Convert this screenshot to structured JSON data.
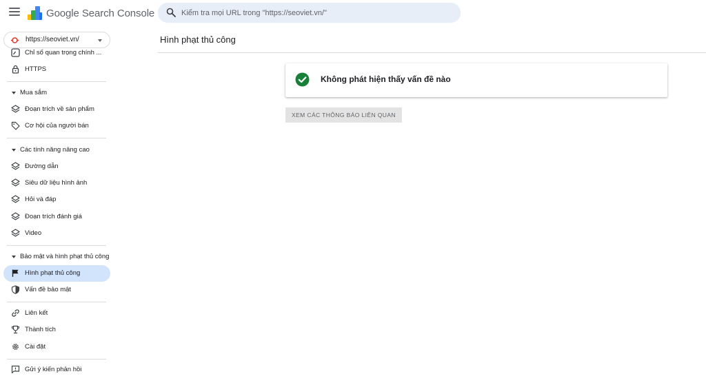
{
  "app": {
    "title": "Google Search Console",
    "brand_colors": [
      "#4285f4",
      "#fbbc04",
      "#34a853",
      "#ea4335"
    ]
  },
  "search": {
    "placeholder": "Kiểm tra mọi URL trong \"https://seoviet.vn/\"",
    "value": ""
  },
  "property": {
    "label": "https://seoviet.vn/"
  },
  "sidebar": {
    "items": [
      {
        "label": "Chỉ số quan trọng chính ...",
        "icon": "speed-icon"
      },
      {
        "label": "HTTPS",
        "icon": "lock-icon"
      },
      {
        "label": "Mua sắm",
        "type": "section"
      },
      {
        "label": "Đoạn trích về sản phẩm",
        "icon": "layers-icon"
      },
      {
        "label": "Cơ hội của người bán",
        "icon": "tag-icon"
      },
      {
        "label": "Các tính năng nâng cao",
        "type": "section"
      },
      {
        "label": "Đường dẫn",
        "icon": "layers-icon"
      },
      {
        "label": "Siêu dữ liệu hình ảnh",
        "icon": "layers-icon"
      },
      {
        "label": "Hỏi và đáp",
        "icon": "layers-icon"
      },
      {
        "label": "Đoạn trích đánh giá",
        "icon": "layers-icon"
      },
      {
        "label": "Video",
        "icon": "layers-icon"
      },
      {
        "label": "Bảo mật và hình phạt thủ công",
        "type": "section"
      },
      {
        "label": "Hình phạt thủ công",
        "icon": "flag-icon",
        "active": true
      },
      {
        "label": "Vấn đề bảo mật",
        "icon": "shield-icon"
      },
      {
        "label": "Liên kết",
        "icon": "link-icon"
      },
      {
        "label": "Thành tích",
        "icon": "trophy-icon"
      },
      {
        "label": "Cài đặt",
        "icon": "gear-icon"
      },
      {
        "label": "Gửi ý kiến phản hồi",
        "icon": "feedback-icon"
      }
    ]
  },
  "main": {
    "title": "Hình phạt thủ công",
    "status_text": "Không phát hiện thấy vấn đề nào",
    "status_color": "#188038",
    "related_button": "XEM CÁC THÔNG BÁO LIÊN QUAN"
  },
  "colors": {
    "active_nav": "#d2e3fc",
    "search_bg": "#e8eef7"
  }
}
